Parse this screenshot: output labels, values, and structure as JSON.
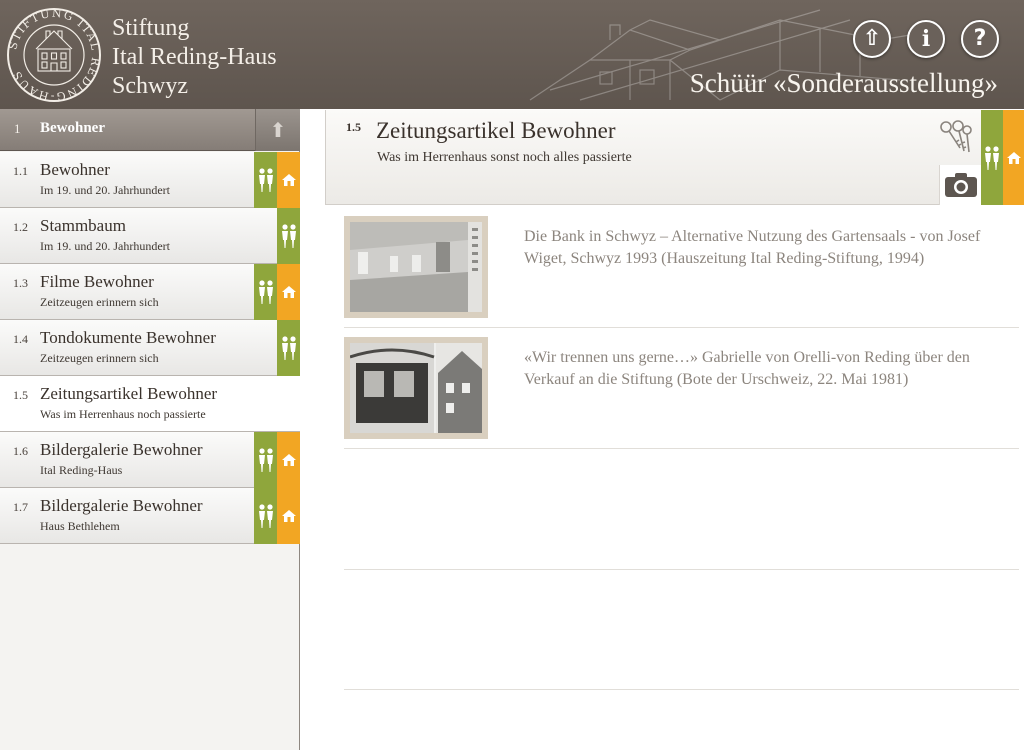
{
  "header": {
    "logo": {
      "ring_text": "STIFTUNG ITAL REDING-HAUS"
    },
    "brand_lines": [
      "Stiftung",
      "Ital Reding-Haus",
      "Schwyz"
    ],
    "title": "Schüür «Sonderausstellung»",
    "buttons": [
      {
        "name": "up-arrow-icon",
        "glyph": "⇧"
      },
      {
        "name": "info-icon",
        "glyph": "i"
      },
      {
        "name": "help-icon",
        "glyph": "?"
      }
    ]
  },
  "sidebar": {
    "header": {
      "num": "1",
      "label": "Bewohner"
    },
    "items": [
      {
        "num": "1.1",
        "title": "Bewohner",
        "subtitle": "Im 19. und 20. Jahrhundert",
        "badges": [
          "green",
          "orange"
        ],
        "active": false
      },
      {
        "num": "1.2",
        "title": "Stammbaum",
        "subtitle": "Im 19. und 20. Jahrhundert",
        "badges": [
          "green"
        ],
        "active": false
      },
      {
        "num": "1.3",
        "title": "Filme Bewohner",
        "subtitle": "Zeitzeugen erinnern sich",
        "badges": [
          "green",
          "orange"
        ],
        "active": false
      },
      {
        "num": "1.4",
        "title": "Tondokumente Bewohner",
        "subtitle": "Zeitzeugen erinnern sich",
        "badges": [
          "green"
        ],
        "active": false
      },
      {
        "num": "1.5",
        "title": "Zeitungsartikel Bewohner",
        "subtitle": "Was im Herrenhaus noch passierte",
        "badges": [],
        "active": true
      },
      {
        "num": "1.6",
        "title": "Bildergalerie Bewohner",
        "subtitle": "Ital Reding-Haus",
        "badges": [
          "green",
          "orange"
        ],
        "active": false
      },
      {
        "num": "1.7",
        "title": "Bildergalerie Bewohner",
        "subtitle": "Haus Bethlehem",
        "badges": [
          "green",
          "orange"
        ],
        "active": false
      }
    ]
  },
  "content": {
    "num": "1.5",
    "title": "Zeitungsartikel Bewohner",
    "subtitle": "Was im Herrenhaus sonst noch alles passierte",
    "articles": [
      {
        "text": "Die Bank in Schwyz – Alternative Nutzung des Gartensaals - von Josef Wiget, Schwyz 1993 (Hauszeitung Ital Reding-Stiftung, 1994)"
      },
      {
        "text": "«Wir trennen uns gerne…» Gabrielle von Orelli-von Reding über den Verkauf an die Stiftung (Bote der Urschweiz, 22. Mai 1981)"
      }
    ]
  },
  "colors": {
    "green": "#8fa63c",
    "orange": "#f2a623",
    "header": "#655c55"
  }
}
